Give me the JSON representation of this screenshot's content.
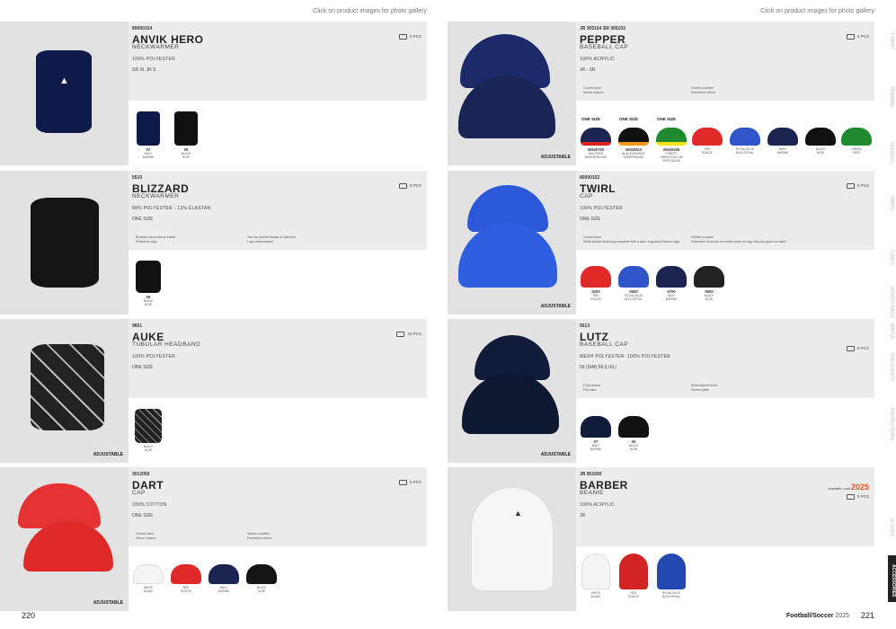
{
  "hint": "Click on product images for photo gallery",
  "left_page_number": "220",
  "right_page_number": "221",
  "footer": {
    "brand": "Football/Soccer",
    "year": "2025"
  },
  "sidebar_tabs": [
    "T-SHIRT",
    "TRAINING",
    "HOODIES",
    "PANTS",
    "COATS",
    "SPORTS BAGS",
    "MATCH",
    "TRACKSUITS",
    "PROTECTIONS",
    "ACCESSORIES",
    "GLOVES"
  ],
  "active_tab": "ACCESSORIES",
  "left_products": [
    {
      "code": "80000154",
      "name": "ANVIK HERO",
      "type": "NECKWARMER",
      "material": "100% POLYESTER",
      "size_label": "SR  XL   JR  S",
      "pcs": "5 PCS",
      "features": [],
      "adjustable": "",
      "swatches": [
        {
          "code": "07",
          "name": "NAVY",
          "fr": "MARINE",
          "color": "#0d1a4a"
        },
        {
          "code": "09",
          "name": "BLACK",
          "fr": "NOIR",
          "color": "#111"
        }
      ]
    },
    {
      "code": "5510",
      "name": "BLIZZARD",
      "type": "NECKWARMER",
      "material": "88% POLYESTER - 12% ELASTAN",
      "size_label": "ONE SIZE",
      "pcs": "5 PCS",
      "features": [
        "Brushed micro fleece inside",
        "Reflective logo",
        "Tour de ploche brosse a l'interieur",
        "Logo reflechissant"
      ],
      "adjustable": "",
      "swatches": [
        {
          "code": "09",
          "name": "BLACK",
          "fr": "NOIR",
          "color": "#111"
        }
      ]
    },
    {
      "code": "9651",
      "name": "AUKE",
      "type": "TUBULAR HEADBAND",
      "material": "100% POLYESTER",
      "size_label": "ONE SIZE",
      "pcs": "10 PCS",
      "features": [],
      "adjustable": "ADJUSTABLE",
      "swatches": [
        {
          "code": "",
          "name": "BLACK",
          "fr": "NOIR",
          "color": "#222"
        }
      ]
    },
    {
      "code": "3012050",
      "name": "DART",
      "type": "CAP",
      "material": "100% COTTON",
      "size_label": "ONE SIZE",
      "pcs": "5 PCS",
      "features": [
        "Curved visor",
        "Velcro closure",
        "Visiere courbee",
        "Fermeture velcro"
      ],
      "adjustable": "ADJUSTABLE",
      "swatches": [
        {
          "code": "",
          "name": "WHITE",
          "fr": "BLANC",
          "color": "#f4f4f4"
        },
        {
          "code": "",
          "name": "RED",
          "fr": "ROUGE",
          "color": "#e02a2a"
        },
        {
          "code": "",
          "name": "NAVY",
          "fr": "MARINE",
          "color": "#1c2452"
        },
        {
          "code": "",
          "name": "BLACK",
          "fr": "NOIR",
          "color": "#151515"
        }
      ]
    }
  ],
  "right_products": [
    {
      "code": "JR 305104  SR 305103",
      "name": "PEPPER",
      "type": "BASEBALL CAP",
      "material": "100% ACRYLIC",
      "size_label": "JR - SR",
      "pcs": "5 PCS",
      "features": [
        "Curved visor",
        "Velcro closure",
        "Visiere courbee",
        "Fermeture velcro"
      ],
      "adjustable": "ADJUSTABLE",
      "one_size": "ONE SIZE",
      "swatches": [
        {
          "code": "30520702",
          "name": "NAVY/RED",
          "fr": "MARINE/ROUGE",
          "color": "#1c2452",
          "top": "#d22"
        },
        {
          "code": "30520913",
          "name": "BLACK/ORANGE",
          "fr": "NOIR/ORANGE",
          "color": "#111",
          "top": "#f39a1a"
        },
        {
          "code": "30520405",
          "name": "FOREST GREEN/YELLOW",
          "fr": "VERT/JAUNE",
          "color": "#1f8a2e",
          "top": "#f4e21a"
        },
        {
          "code": "",
          "name": "RED",
          "fr": "ROUGE",
          "color": "#e02a2a",
          "top": ""
        },
        {
          "code": "",
          "name": "ROYAL BLUE",
          "fr": "BLEU ROYAL",
          "color": "#2f55c9",
          "top": ""
        },
        {
          "code": "",
          "name": "NAVY",
          "fr": "MARINE",
          "color": "#1c2452",
          "top": ""
        },
        {
          "code": "",
          "name": "BLACK",
          "fr": "NOIR",
          "color": "#111",
          "top": ""
        },
        {
          "code": "",
          "name": "GREEN",
          "fr": "VERT",
          "color": "#1f8a2e",
          "top": ""
        }
      ]
    },
    {
      "code": "80000152",
      "name": "TWIRL",
      "type": "CAP",
      "material": "100% POLYESTER",
      "size_label": "ONE SIZE",
      "pcs": "5 PCS",
      "features": [
        "Curved visor",
        "Metal buckle fastening complete with a laser engraved Macron logo",
        "Visiere courbee",
        "Fermeture a boucle en metal ornee du logo Macron grave au laser"
      ],
      "adjustable": "ADJUSTABLE",
      "swatches": [
        {
          "code": "0200",
          "name": "RED",
          "fr": "ROUGE",
          "color": "#e02a2a"
        },
        {
          "code": "0500",
          "name": "ROYAL BLUE",
          "fr": "BLEU ROYAL",
          "color": "#2f55c9"
        },
        {
          "code": "0700",
          "name": "NAVY",
          "fr": "MARINE",
          "color": "#1c2452"
        },
        {
          "code": "0900",
          "name": "BLACK",
          "fr": "NOIR",
          "color": "#222"
        }
      ]
    },
    {
      "code": "5513",
      "name": "LUTZ",
      "type": "BASEBALL CAP",
      "material": "MESH POLYESTER: 100% POLYESTER",
      "size_label": "56 (S/M)   58 (L/XL)",
      "pcs": "6 PCS",
      "features": [
        "Fully closed",
        "Flat visor",
        "Embroidered front",
        "Visiere plate"
      ],
      "adjustable": "ADJUSTABLE",
      "swatches": [
        {
          "code": "07",
          "name": "NAVY",
          "fr": "MARINE",
          "color": "#101c3a"
        },
        {
          "code": "09",
          "name": "BLACK",
          "fr": "NOIR",
          "color": "#111"
        }
      ]
    },
    {
      "code": "JR 951500",
      "name": "BARBER",
      "type": "BEANIE",
      "material": "100% ACRYLIC",
      "size_label": "JR",
      "pcs": "5 PCS",
      "features": [],
      "adjustable": "",
      "available_label": "Available until",
      "available_year": "2025",
      "swatches": [
        {
          "code": "",
          "name": "WHITE",
          "fr": "BLANC",
          "color": "#f4f4f4"
        },
        {
          "code": "",
          "name": "RED",
          "fr": "ROUGE",
          "color": "#d32424"
        },
        {
          "code": "",
          "name": "ROYAL BLUE",
          "fr": "BLEU ROYAL",
          "color": "#2349b0"
        }
      ]
    }
  ]
}
